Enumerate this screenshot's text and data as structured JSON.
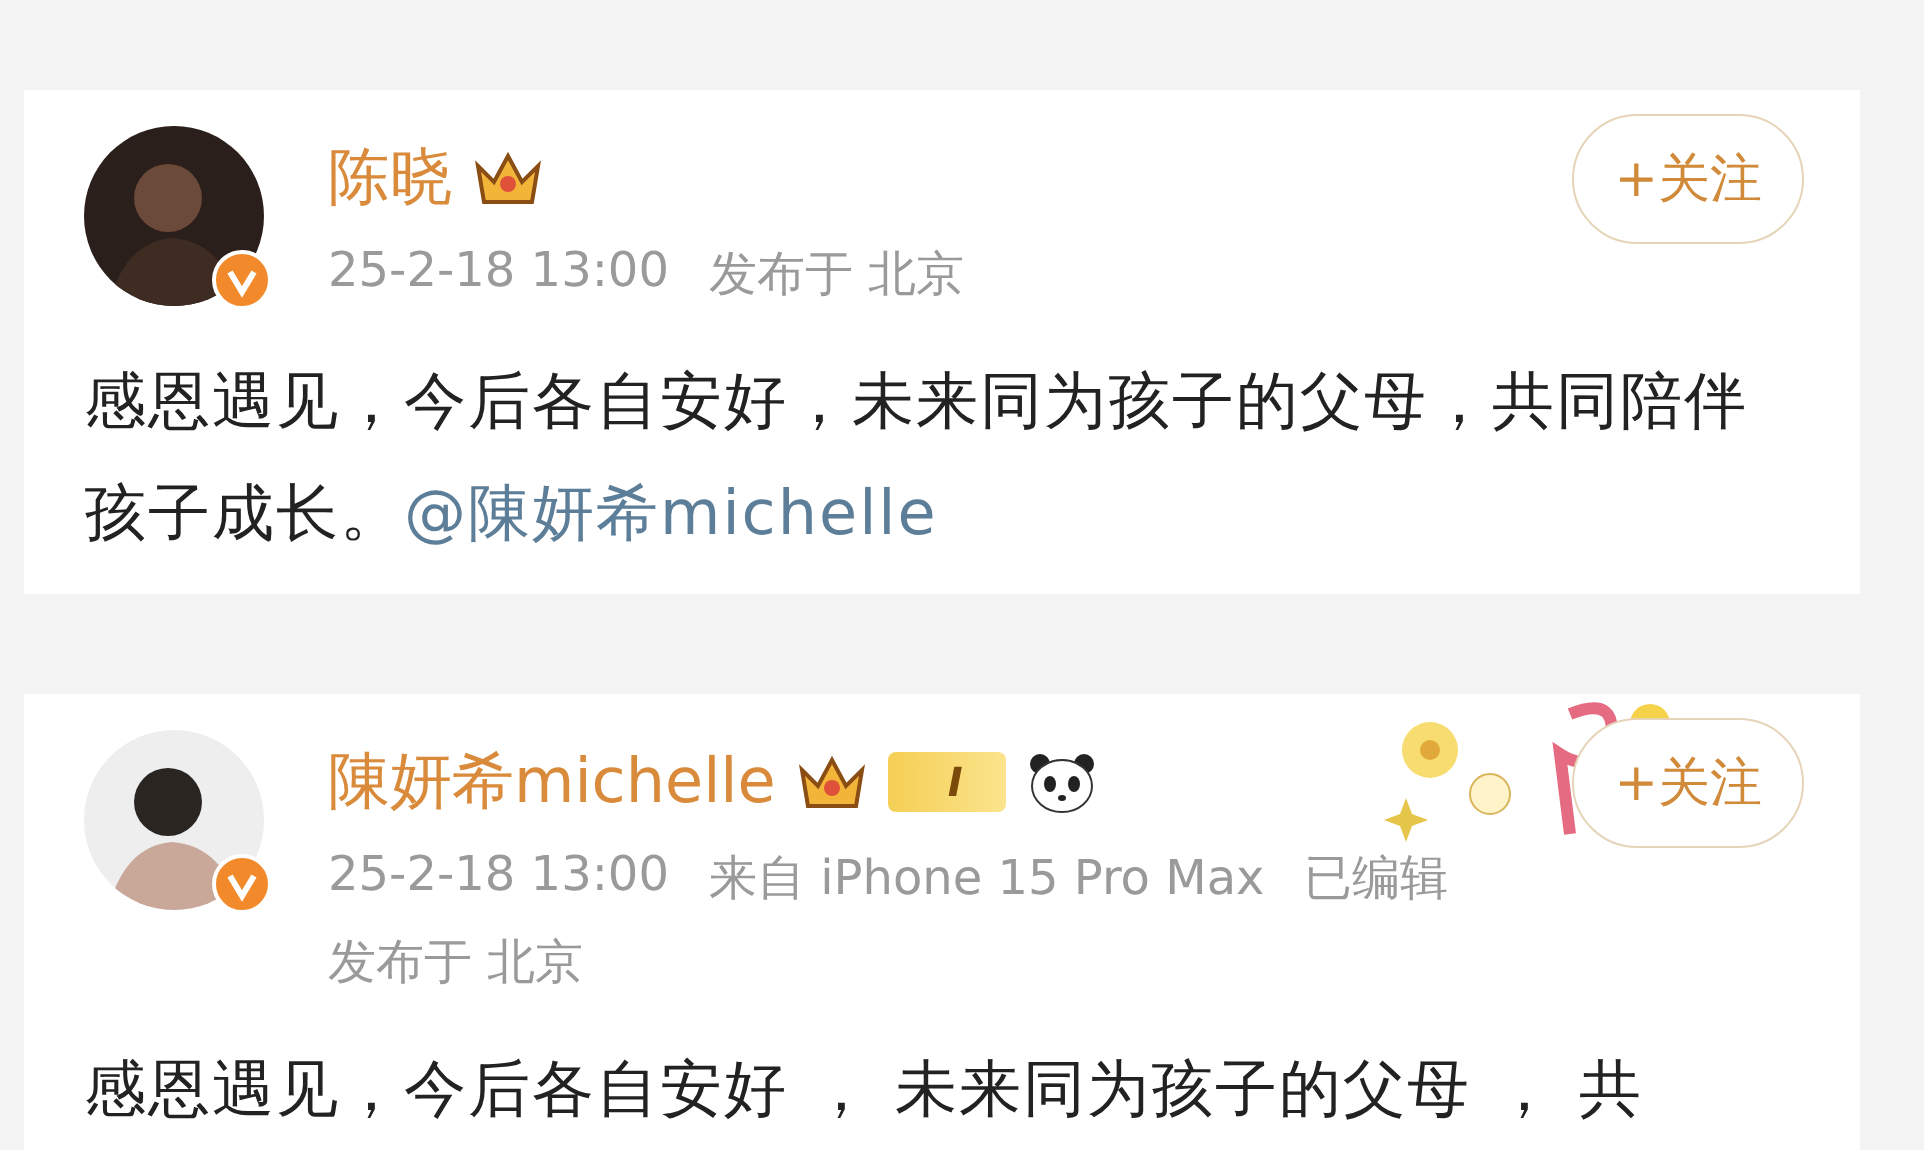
{
  "posts": [
    {
      "author": "陈晓",
      "verified": true,
      "crown": true,
      "panda": false,
      "decorated": false,
      "time": "25-2-18 13:00",
      "location": "发布于 北京",
      "text": "感恩遇见，今后各自安好，未来同为孩子的父母，共同陪伴孩子成长。",
      "mention": "@陳妍希michelle",
      "follow": "+关注"
    },
    {
      "author": "陳妍希michelle",
      "verified": true,
      "crown": true,
      "level_badge": "I",
      "panda": true,
      "decorated": true,
      "time": "25-2-18 13:00",
      "source": "来自 iPhone 15 Pro Max",
      "edited": "已编辑",
      "location": "发布于 北京",
      "text": "感恩遇见，今后各自安好 ， 未来同为孩子的父母 ， 共",
      "follow": "+关注"
    }
  ]
}
